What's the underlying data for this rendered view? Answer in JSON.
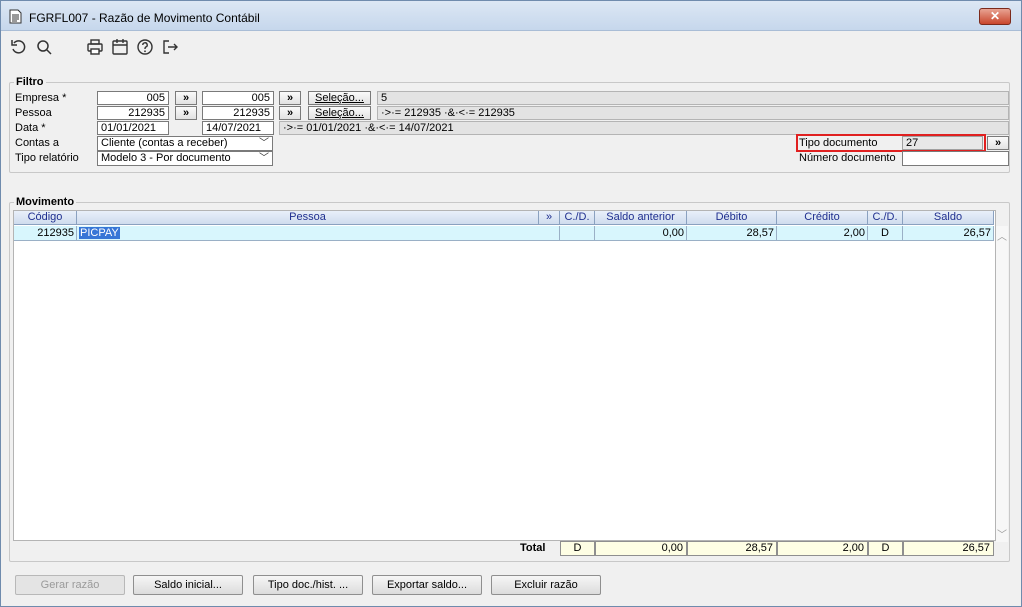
{
  "window": {
    "title": "FGRFL007 - Razão de Movimento Contábil",
    "close_label": "✕"
  },
  "toolbar": {
    "icons": [
      "undo-icon",
      "search-icon",
      "print-icon",
      "calendar-icon",
      "help-icon",
      "exit-icon"
    ]
  },
  "filtro": {
    "legend": "Filtro",
    "empresa": {
      "label": "Empresa *",
      "from": "005",
      "to": "005",
      "arrow": "»",
      "selecao": "Seleção...",
      "info": "5"
    },
    "pessoa": {
      "label": "Pessoa",
      "from": "212935",
      "to": "212935",
      "arrow": "»",
      "selecao": "Seleção...",
      "info": "·>·= 212935 ·&·<·= 212935"
    },
    "data": {
      "label": "Data *",
      "from": "01/01/2021",
      "to": "14/07/2021",
      "info": "·>·= 01/01/2021 ·&·<·= 14/07/2021"
    },
    "contas": {
      "label": "Contas a",
      "value": "Cliente (contas a receber)"
    },
    "tipo_relatorio": {
      "label": "Tipo relatório",
      "value": "Modelo 3 - Por documento"
    },
    "tipo_documento": {
      "label": "Tipo documento",
      "value": "27",
      "arrow": "»"
    },
    "numero_documento": {
      "label": "Número documento",
      "value": ""
    }
  },
  "movimento": {
    "legend": "Movimento",
    "columns": {
      "codigo": "Código",
      "pessoa": "Pessoa",
      "arrow": "»",
      "cd1": "C./D.",
      "saldo_anterior": "Saldo anterior",
      "debito": "Débito",
      "credito": "Crédito",
      "cd2": "C./D.",
      "saldo": "Saldo"
    },
    "rows": [
      {
        "codigo": "212935",
        "pessoa": "PICPAY",
        "cd1": "",
        "saldo_anterior": "0,00",
        "debito": "28,57",
        "credito": "2,00",
        "cd2": "D",
        "saldo": "26,57"
      }
    ],
    "total": {
      "label": "Total",
      "cd1": "D",
      "saldo_anterior": "0,00",
      "debito": "28,57",
      "credito": "2,00",
      "cd2": "D",
      "saldo": "26,57"
    }
  },
  "buttons": {
    "gerar_razao": "Gerar razão",
    "saldo_inicial": "Saldo inicial...",
    "tipo_doc_hist": "Tipo doc./hist. ...",
    "exportar_saldo": "Exportar saldo...",
    "excluir_razao": "Excluir razão"
  }
}
